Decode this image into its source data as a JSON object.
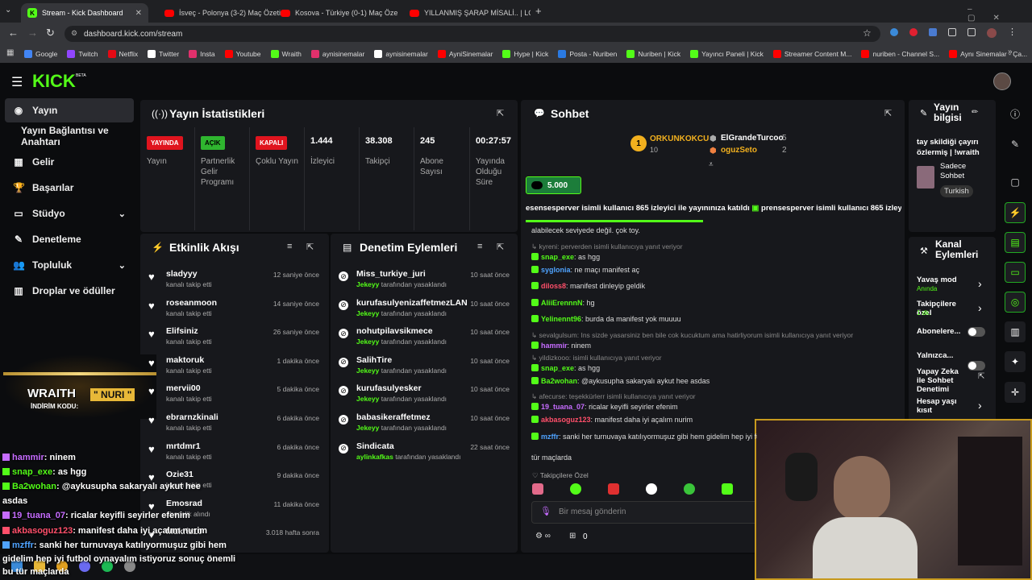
{
  "browser": {
    "tabs": [
      {
        "title": "Stream - Kick Dashboard",
        "icon": "kick-icon"
      },
      {
        "title": "İsveç - Polonya (3-2) Maç Özeti",
        "icon": "youtube-icon"
      },
      {
        "title": "Kosova - Türkiye (0-1) Maç Öze",
        "icon": "youtube-icon"
      },
      {
        "title": "YILLANMIŞ ŞARAP MİSALİ.. | LO",
        "icon": "youtube-icon"
      }
    ],
    "url": "dashboard.kick.com/stream",
    "bookmarks": [
      "Google",
      "Twitch",
      "Netflix",
      "Twitter",
      "Insta",
      "Youtube",
      "Wraith",
      "aynisinemalar",
      "aynisinemalar",
      "AyniSinemalar",
      "Hype | Kick",
      "Posta - Nuriben",
      "Nuriben | Kick",
      "Yayıncı Paneli | Kick",
      "Streamer Content M...",
      "nuriben - Channel S...",
      "Aynı Sinemalar - Ça..."
    ]
  },
  "header": {
    "logo": "KICK",
    "logo_beta": "BETA"
  },
  "sidebar": {
    "items": [
      {
        "label": "Yayın",
        "icon": "broadcast-icon"
      },
      {
        "label": "Yayın Bağlantısı ve Anahtarı",
        "icon": ""
      },
      {
        "label": "Gelir",
        "icon": "money-icon"
      },
      {
        "label": "Başarılar",
        "icon": "trophy-icon"
      },
      {
        "label": "Stüdyo",
        "icon": "studio-icon"
      },
      {
        "label": "Denetleme",
        "icon": "wrench-icon"
      },
      {
        "label": "Topluluk",
        "icon": "community-icon"
      },
      {
        "label": "Droplar ve ödüller",
        "icon": "gift-icon"
      }
    ]
  },
  "stats": {
    "title": "Yayın İstatistikleri",
    "items": [
      {
        "badge": "YAYINDA",
        "label": "Yayın",
        "color": "#e0141e"
      },
      {
        "badge": "AÇIK",
        "label": "Partnerlik Gelir Programı",
        "color": "#2fb52f"
      },
      {
        "badge": "KAPALI",
        "label": "Çoklu Yayın",
        "color": "#e0141e"
      },
      {
        "value": "1.444",
        "label": "İzleyici"
      },
      {
        "value": "38.308",
        "label": "Takipçi"
      },
      {
        "value": "245",
        "label": "Abone Sayısı"
      },
      {
        "value": "00:27:57",
        "label": "Yayında Olduğu Süre"
      }
    ]
  },
  "activity": {
    "title": "Etkinlik Akışı",
    "rows": [
      {
        "user": "sladyyy",
        "sub": "kanalı takip etti",
        "time": "12 saniye önce"
      },
      {
        "user": "roseanmoon",
        "sub": "kanalı takip etti",
        "time": "14 saniye önce"
      },
      {
        "user": "Elifsiniz",
        "sub": "kanalı takip etti",
        "time": "26 saniye önce"
      },
      {
        "user": "maktoruk",
        "sub": "kanalı takip etti",
        "time": "1 dakika önce"
      },
      {
        "user": "mervii00",
        "sub": "kanalı takip etti",
        "time": "5 dakika önce"
      },
      {
        "user": "ebrarnzkinali",
        "sub": "kanalı takip etti",
        "time": "6 dakika önce"
      },
      {
        "user": "mrtdmr1",
        "sub": "kanalı takip etti",
        "time": "6 dakika önce"
      },
      {
        "user": "Ozie31",
        "sub": "kanalı takip etti",
        "time": "9 dakika önce"
      },
      {
        "user": "Emosrad",
        "sub": "abonelik alındı",
        "time": "11 dakika önce"
      },
      {
        "user": "Mukriz10",
        "sub": "",
        "time": "3.018 hafta sonra"
      }
    ]
  },
  "moderation": {
    "title": "Denetim Eylemleri",
    "rows": [
      {
        "user": "Miss_turkiye_juri",
        "mod": "Jekeyy",
        "action": "tarafından yasaklandı",
        "time": "10 saat önce"
      },
      {
        "user": "kurufasulyenizaffetmezLAN",
        "mod": "Jekeyy",
        "action": "tarafından yasaklandı",
        "time": "10 saat önce"
      },
      {
        "user": "nohutpilavsikmece",
        "mod": "Jekeyy",
        "action": "tarafından yasaklandı",
        "time": "10 saat önce"
      },
      {
        "user": "SalihTire",
        "mod": "Jekeyy",
        "action": "tarafından yasaklandı",
        "time": "10 saat önce"
      },
      {
        "user": "kurufasulyesker",
        "mod": "Jekeyy",
        "action": "tarafından yasaklandı",
        "time": "10 saat önce"
      },
      {
        "user": "babasikeraffetmez",
        "mod": "Jekeyy",
        "action": "tarafından yasaklandı",
        "time": "10 saat önce"
      },
      {
        "user": "Sindicata",
        "mod": "aylinkafkas",
        "action": "tarafından yasaklandı",
        "time": "22 saat önce"
      }
    ]
  },
  "chat": {
    "title": "Sohbet",
    "leaders": [
      {
        "name": "ORKUNKOKCU",
        "count": "10"
      },
      {
        "name": "ElGrandeTurcoo",
        "count": "5"
      },
      {
        "name": "oguzSeto",
        "count": "2"
      }
    ],
    "kicks_badge": "5.000",
    "ticker": "esensesperver isimli kullanıcı 865 izleyici ile yayınınıza katıldı",
    "ticker2": "prensesperver isimli kullanıcı 865 izleyici",
    "lines": [
      {
        "reply": "",
        "user": "",
        "color": "#ddd",
        "text": "alabilecek seviyede değil. çok toy."
      },
      {
        "reply": "kyreni: perverden isimli kullanıcıya yanıt veriyor",
        "user": "snap_exe",
        "color": "#53fc18",
        "text": "as hgg"
      },
      {
        "reply": "",
        "user": "syglonia",
        "color": "#4fa3ff",
        "text": "ne maçı manifest aç"
      },
      {
        "reply": "",
        "user": "diloss8",
        "color": "#ff4f6a",
        "text": "manifest dinleyip geldik"
      },
      {
        "reply": "",
        "user": "AliiErennnN",
        "color": "#53fc18",
        "text": "hg"
      },
      {
        "reply": "",
        "user": "Yelinennt96",
        "color": "#53fc18",
        "text": "burda da manifest yok muuuu"
      },
      {
        "reply": "sevalgulsum: Ins sizde yasarsiniz ben bile cok kucuktum ama hatirliyorum isimli kullanıcıya yanıt veriyor",
        "user": "hammir",
        "color": "#c66cff",
        "text": "ninem"
      },
      {
        "reply": "yildizkooo: isimli kullanıcıya yanıt veriyor",
        "user": "snap_exe",
        "color": "#53fc18",
        "text": "as hgg"
      },
      {
        "reply": "",
        "user": "Ba2wohan",
        "color": "#53fc18",
        "text": "@aykusupha sakaryalı aykut hee asdas"
      },
      {
        "reply": "afecurse: teşekkürlerr isimli kullanıcıya yanıt veriyor",
        "user": "19_tuana_07",
        "color": "#c66cff",
        "text": "ricalar keyifli seyirler efenim"
      },
      {
        "reply": "",
        "user": "akbasoguz123",
        "color": "#ff4f6a",
        "text": "manifest daha iyi açalım nurim"
      },
      {
        "reply": "",
        "user": "mzffr",
        "color": "#4fa3ff",
        "text": "sanki her turnuvaya katılıyormuşuz gibi hem gidelim hep iyi fu"
      }
    ],
    "last_wrap": "tür maçlarda",
    "followers_only": "Takipçilere Özel",
    "input_placeholder": "Bir mesaj gönderin",
    "footer_count": "0"
  },
  "stream_info": {
    "title": "Yayın bilgisi",
    "description": "tay skildiği çayırı özlermiş | !wraith",
    "category": "Sadece Sohbet",
    "language": "Turkish"
  },
  "channel_actions": {
    "title": "Kanal Eylemleri",
    "items": [
      {
        "label": "Yavaş mod",
        "sub": "Anında",
        "control": "chevron"
      },
      {
        "label": "Takipçilere özel",
        "sub": "1 dk.",
        "control": "chevron"
      },
      {
        "label": "Abonelere...",
        "sub": "",
        "control": "toggle"
      },
      {
        "label": "Yalnızca...",
        "sub": "",
        "control": "toggle"
      },
      {
        "label": "Yapay Zeka ile Sohbet Denetimi",
        "sub": "",
        "control": "external"
      },
      {
        "label": "Hesap yaşı kısıt",
        "sub": "",
        "control": "chevron"
      }
    ]
  },
  "overlay": {
    "promo_title": "WRAITH",
    "promo_code_label": "İNDİRİM KODU:",
    "promo_code": "\" NURI \"",
    "lines": [
      {
        "user": "hammir",
        "color": "#c66cff",
        "text": ": ninem"
      },
      {
        "user": "snap_exe",
        "color": "#53fc18",
        "text": ": as hgg"
      },
      {
        "user": "Ba2wohan",
        "color": "#53fc18",
        "text": ": @aykusupha sakaryalı aykut hee"
      },
      {
        "user": "",
        "color": "#fff",
        "text": "asdas"
      },
      {
        "user": "19_tuana_07",
        "color": "#c66cff",
        "text": ": ricalar keyifli seyirler efenim"
      },
      {
        "user": "akbasoguz123",
        "color": "#ff4f6a",
        "text": ": manifest daha iyi açalım nurim"
      },
      {
        "user": "mzffr",
        "color": "#4fa3ff",
        "text": ": sanki her turnuvaya katılıyormuşuz gibi hem"
      },
      {
        "user": "",
        "color": "#fff",
        "text": "gidelim hep iyi futbol oynayalım istiyoruz sonuç önemli"
      },
      {
        "user": "",
        "color": "#fff",
        "text": "bu tür maçlarda"
      }
    ]
  }
}
